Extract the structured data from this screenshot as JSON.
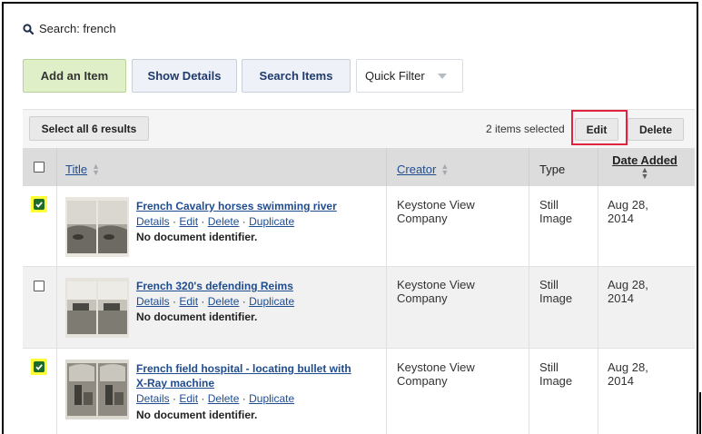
{
  "search": {
    "label": "Search: french"
  },
  "buttons": {
    "add_item": "Add an Item",
    "show_details": "Show Details",
    "search_items": "Search Items",
    "quick_filter": "Quick Filter"
  },
  "toolbar": {
    "select_all": "Select all 6 results",
    "selected_count": "2 items selected",
    "edit": "Edit",
    "delete": "Delete"
  },
  "columns": {
    "title": "Title",
    "creator": "Creator",
    "type": "Type",
    "date_added": "Date Added"
  },
  "rows": [
    {
      "checked": true,
      "title": "French Cavalry horses swimming river",
      "title_line2": "",
      "actions": {
        "details": "Details",
        "edit": "Edit",
        "delete": "Delete",
        "duplicate": "Duplicate",
        "separator": "·"
      },
      "identifier": "No document identifier.",
      "creator": "Keystone View",
      "creator_line2": "Company",
      "type": "Still",
      "type_line2": "Image",
      "date": "Aug 28,",
      "date_line2": "2014"
    },
    {
      "checked": false,
      "title": "French 320's defending Reims",
      "title_line2": "",
      "actions": {
        "details": "Details",
        "edit": "Edit",
        "delete": "Delete",
        "duplicate": "Duplicate",
        "separator": "·"
      },
      "identifier": "No document identifier.",
      "creator": "Keystone View",
      "creator_line2": "Company",
      "type": "Still",
      "type_line2": "Image",
      "date": "Aug 28,",
      "date_line2": "2014"
    },
    {
      "checked": true,
      "title": "French field hospital - locating bullet with",
      "title_line2": "X-Ray machine",
      "actions": {
        "details": "Details",
        "edit": "Edit",
        "delete": "Delete",
        "duplicate": "Duplicate",
        "separator": "·"
      },
      "identifier": "No document identifier.",
      "creator": "Keystone View",
      "creator_line2": "Company",
      "type": "Still",
      "type_line2": "Image",
      "date": "Aug 28,",
      "date_line2": "2014"
    }
  ],
  "colors": {
    "add_bg": "#dff0c8",
    "link": "#1f4c8f",
    "checkbox_highlight": "#ffff33",
    "checkbox_checked": "#1c6b2a",
    "callout": "#e0243d"
  }
}
